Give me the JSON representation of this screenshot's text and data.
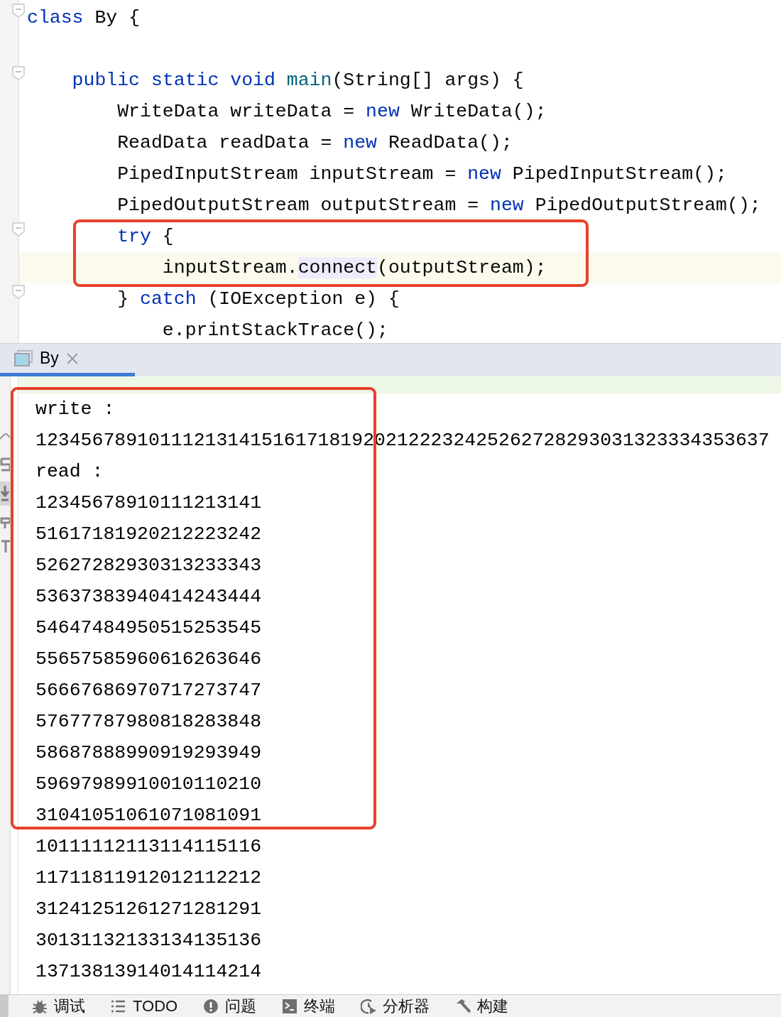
{
  "editor": {
    "lines": [
      {
        "kind": "code",
        "fold_marker": true,
        "current": false,
        "segments": [
          {
            "kind": "keyword",
            "text": "class"
          },
          {
            "kind": "plain",
            "text": " By {"
          }
        ]
      },
      {
        "kind": "blank"
      },
      {
        "kind": "code",
        "fold_marker": true,
        "current": false,
        "segments": [
          {
            "kind": "keyword",
            "text": "    public static void"
          },
          {
            "kind": "method",
            "text": " main"
          },
          {
            "kind": "plain",
            "text": "(String[] args) {"
          }
        ]
      },
      {
        "kind": "code",
        "fold_marker": false,
        "current": false,
        "segments": [
          {
            "kind": "plain",
            "text": "        WriteData writeData = "
          },
          {
            "kind": "keyword",
            "text": "new"
          },
          {
            "kind": "plain",
            "text": " WriteData();"
          }
        ]
      },
      {
        "kind": "code",
        "fold_marker": false,
        "current": false,
        "segments": [
          {
            "kind": "plain",
            "text": "        ReadData readData = "
          },
          {
            "kind": "keyword",
            "text": "new"
          },
          {
            "kind": "plain",
            "text": " ReadData();"
          }
        ]
      },
      {
        "kind": "code",
        "fold_marker": false,
        "current": false,
        "segments": [
          {
            "kind": "plain",
            "text": "        PipedInputStream inputStream = "
          },
          {
            "kind": "keyword",
            "text": "new"
          },
          {
            "kind": "plain",
            "text": " PipedInputStream();"
          }
        ]
      },
      {
        "kind": "code",
        "fold_marker": false,
        "current": false,
        "segments": [
          {
            "kind": "plain",
            "text": "        PipedOutputStream outputStream = "
          },
          {
            "kind": "keyword",
            "text": "new"
          },
          {
            "kind": "plain",
            "text": " PipedOutputStream();"
          }
        ]
      },
      {
        "kind": "code",
        "fold_marker": true,
        "current": false,
        "segments": [
          {
            "kind": "keyword",
            "text": "        try"
          },
          {
            "kind": "plain",
            "text": " {"
          }
        ]
      },
      {
        "kind": "code",
        "fold_marker": false,
        "current": true,
        "segments": [
          {
            "kind": "plain",
            "text": "            inputStream."
          },
          {
            "kind": "usage",
            "text": "connect"
          },
          {
            "kind": "plain",
            "text": "(outputStream);"
          }
        ]
      },
      {
        "kind": "code",
        "fold_marker": true,
        "current": false,
        "segments": [
          {
            "kind": "plain",
            "text": "        } "
          },
          {
            "kind": "keyword",
            "text": "catch"
          },
          {
            "kind": "plain",
            "text": " (IOException e) {"
          }
        ]
      },
      {
        "kind": "code",
        "fold_marker": false,
        "current": false,
        "segments": [
          {
            "kind": "plain",
            "text": "            e.printStackTrace();"
          }
        ]
      }
    ]
  },
  "run_panel": {
    "tabs": [
      {
        "label": "By",
        "selected": true
      }
    ],
    "output": [
      "write :",
      "12345678910111213141516171819202122232425262728293031323334353637",
      "read :",
      "12345678910111213141",
      "51617181920212223242",
      "52627282930313233343",
      "53637383940414243444",
      "54647484950515253545",
      "55657585960616263646",
      "56667686970717273747",
      "57677787980818283848",
      "58687888990919293949",
      "59697989910010110210",
      "31041051061071081091",
      "10111112113114115116",
      "11711811912012112212",
      "31241251261271281291",
      "30131132133134135136",
      "13713813914014114214"
    ]
  },
  "bottom_toolbar": [
    {
      "kind": "debug",
      "label": "调试"
    },
    {
      "kind": "todo",
      "label": "TODO"
    },
    {
      "kind": "problems",
      "label": "问题"
    },
    {
      "kind": "terminal",
      "label": "终端"
    },
    {
      "kind": "profiler",
      "label": "分析器"
    },
    {
      "kind": "build",
      "label": "构建"
    }
  ]
}
